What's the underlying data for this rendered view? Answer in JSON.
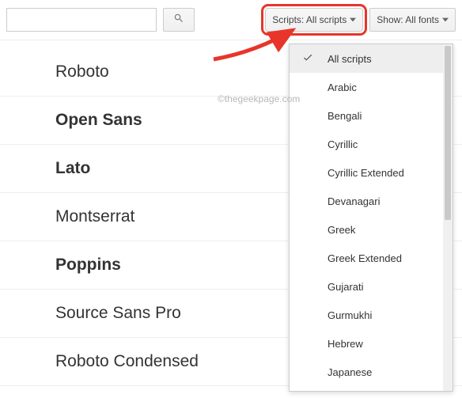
{
  "search": {
    "value": "",
    "placeholder": ""
  },
  "scripts_dropdown": {
    "label": "Scripts: All scripts"
  },
  "show_dropdown": {
    "label": "Show: All fonts"
  },
  "fonts": {
    "items": [
      "Roboto",
      "Open Sans",
      "Lato",
      "Montserrat",
      "Poppins",
      "Source Sans Pro",
      "Roboto Condensed"
    ]
  },
  "scripts_menu": {
    "selected_index": 0,
    "items": [
      "All scripts",
      "Arabic",
      "Bengali",
      "Cyrillic",
      "Cyrillic Extended",
      "Devanagari",
      "Greek",
      "Greek Extended",
      "Gujarati",
      "Gurmukhi",
      "Hebrew",
      "Japanese"
    ]
  },
  "watermark": "©thegeekpage.com"
}
